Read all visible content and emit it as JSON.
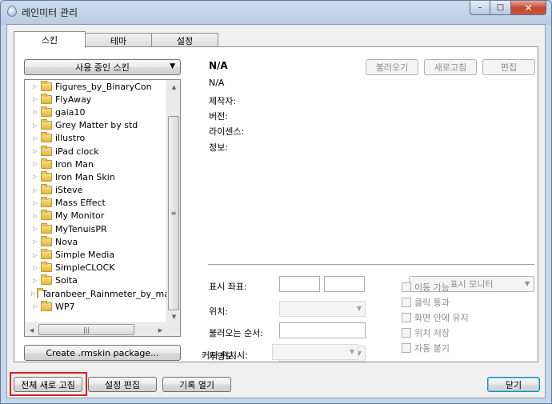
{
  "window": {
    "title": "레인미터 관리",
    "minimize_glyph": "–",
    "maximize_glyph": "□",
    "close_glyph": "✕"
  },
  "tabs": [
    {
      "label": "스킨"
    },
    {
      "label": "테마"
    },
    {
      "label": "설정"
    }
  ],
  "skins_panel": {
    "dropdown_label": "사용 중인 스킨",
    "dropdown_arrow": "▼",
    "tree_items": [
      {
        "label": "Figures_by_BinaryCon"
      },
      {
        "label": "FlyAway"
      },
      {
        "label": "gaia10"
      },
      {
        "label": "Grey Matter by std"
      },
      {
        "label": "illustro"
      },
      {
        "label": "iPad clock"
      },
      {
        "label": "Iron Man"
      },
      {
        "label": "Iron Man Skin"
      },
      {
        "label": "iSteve"
      },
      {
        "label": "Mass Effect"
      },
      {
        "label": "My Monitor"
      },
      {
        "label": "MyTenuisPR"
      },
      {
        "label": "Nova"
      },
      {
        "label": "Simple Media"
      },
      {
        "label": "SimpleCLOCK"
      },
      {
        "label": "Soita"
      },
      {
        "label": "Taranbeer_Rainmeter_by_mar"
      },
      {
        "label": "WP7"
      }
    ],
    "expand_glyph": "▷",
    "create_package_label": "Create .rmskin package..."
  },
  "skin_info": {
    "name": "N/A",
    "config": "N/A",
    "author_label": "제작자:",
    "version_label": "버전:",
    "license_label": "라이센스:",
    "info_label": "정보:",
    "load_button": "불러오기",
    "refresh_button": "새로고침",
    "edit_button": "편집"
  },
  "settings": {
    "coordinates_label": "표시 좌표:",
    "position_label": "위치:",
    "load_order_label": "불러오는 순서:",
    "transparency_label": "투명도:",
    "cursor_label": "커서 위치시:",
    "display_monitor_label": "표시 모니터",
    "checkboxes": [
      {
        "label": "이동 가능",
        "checked": false
      },
      {
        "label": "클릭 통과",
        "checked": false
      },
      {
        "label": "화면 안에 유지",
        "checked": false
      },
      {
        "label": "위치 저장",
        "checked": false
      },
      {
        "label": "자동 붙기",
        "checked": false
      }
    ]
  },
  "footer": {
    "refresh_all": "전체 새로 고침",
    "edit_settings": "설정 편집",
    "open_log": "기록 열기",
    "close": "닫기"
  }
}
